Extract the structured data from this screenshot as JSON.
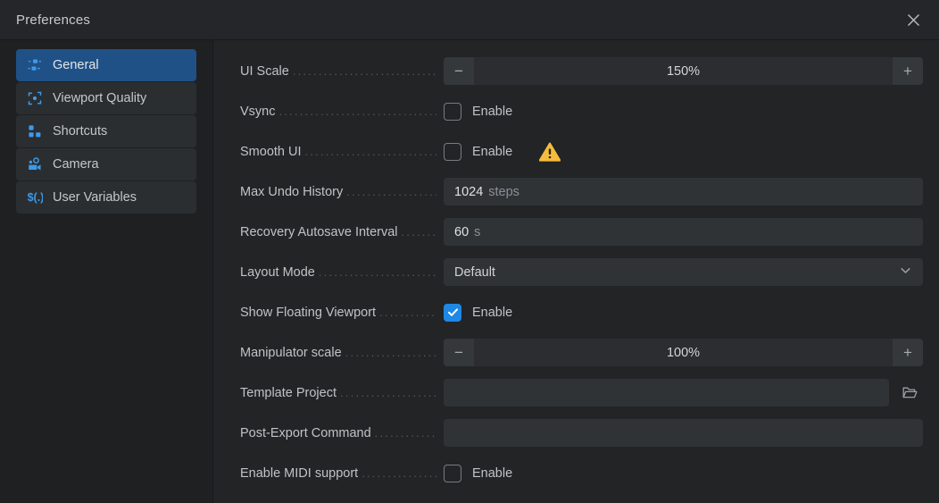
{
  "window": {
    "title": "Preferences",
    "close_icon": "close-icon"
  },
  "colors": {
    "accent_blue": "#1e88e5",
    "selected_nav": "#1f5186",
    "warning_yellow": "#f5bb3c",
    "panel_bg": "#222426",
    "sidebar_bg": "#1e2022",
    "field_bg": "#303336"
  },
  "sidebar": {
    "items": [
      {
        "label": "General",
        "icon": "general-nodes-icon",
        "selected": true
      },
      {
        "label": "Viewport Quality",
        "icon": "viewport-quality-icon",
        "selected": false
      },
      {
        "label": "Shortcuts",
        "icon": "shortcuts-icon",
        "selected": false
      },
      {
        "label": "Camera",
        "icon": "camera-icon",
        "selected": false
      },
      {
        "label": "User Variables",
        "icon": "user-variables-icon",
        "selected": false
      }
    ]
  },
  "settings": {
    "rows": [
      {
        "label": "UI Scale",
        "type": "spinner",
        "value": "150%",
        "minus_label": "−",
        "plus_label": "+"
      },
      {
        "label": "Vsync",
        "type": "checkbox",
        "checkbox_label": "Enable",
        "checked": false,
        "warning": false
      },
      {
        "label": "Smooth UI",
        "type": "checkbox",
        "checkbox_label": "Enable",
        "checked": false,
        "warning": true
      },
      {
        "label": "Max Undo History",
        "type": "textfield",
        "value": "1024",
        "suffix": "steps",
        "placeholder": ""
      },
      {
        "label": "Recovery Autosave Interval",
        "type": "textfield",
        "value": "60",
        "suffix": "s",
        "placeholder": ""
      },
      {
        "label": "Layout Mode",
        "type": "dropdown",
        "value": "Default",
        "options": [
          "Default"
        ]
      },
      {
        "label": "Show Floating Viewport",
        "type": "checkbox",
        "checkbox_label": "Enable",
        "checked": true,
        "warning": false
      },
      {
        "label": "Manipulator scale",
        "type": "spinner",
        "value": "100%",
        "minus_label": "−",
        "plus_label": "+"
      },
      {
        "label": "Template Project",
        "type": "pathfield",
        "value": "",
        "placeholder": "",
        "browse_icon": "folder-open-icon"
      },
      {
        "label": "Post-Export Command",
        "type": "textfield",
        "value": "",
        "suffix": "",
        "placeholder": ""
      },
      {
        "label": "Enable MIDI support",
        "type": "checkbox",
        "checkbox_label": "Enable",
        "checked": false,
        "warning": false
      }
    ]
  }
}
